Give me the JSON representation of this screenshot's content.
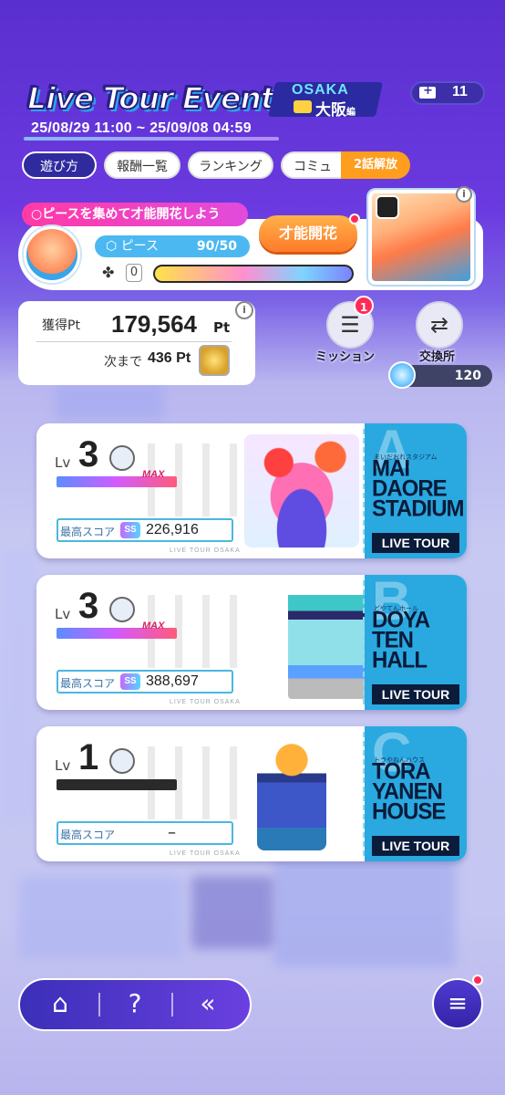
{
  "event": {
    "title": "Live Tour Event",
    "location_top": "OSAKA",
    "location_bottom": "大阪",
    "location_suffix": "編",
    "date_range": "25/08/29 11:00 ~ 25/09/08 04:59"
  },
  "tickets": {
    "count": "11"
  },
  "tabs": {
    "how_to_play": "遊び方",
    "rewards": "報酬一覧",
    "ranking": "ランキング",
    "commu": "コミュ",
    "commu_badge": "2話解放"
  },
  "talent": {
    "banner": "○ピースを集めて才能開花しよう",
    "piece_label": "ピース",
    "piece_value": "90/50",
    "clover_count": "0",
    "bloom_button": "才能開花",
    "info": "i"
  },
  "points": {
    "earned_label": "獲得Pt",
    "earned_value": "179,564",
    "earned_unit": "Pt",
    "next_label": "次まで",
    "next_value": "436 Pt",
    "info": "i"
  },
  "actions": {
    "mission_label": "ミッション",
    "mission_badge": "1",
    "exchange_label": "交換所",
    "coin_count": "120"
  },
  "stages": [
    {
      "letter": "A",
      "subtitle": "まいだおれスタジアム",
      "name": "MAI\nDAORE\nSTADIUM",
      "tour": "LIVE TOUR",
      "lv_label": "Lv",
      "level": "3",
      "max_label": "MAX",
      "score_label": "最高スコア",
      "score_rank": "SS",
      "score": "226,916",
      "footer": "LIVE TOUR OSAKA"
    },
    {
      "letter": "B",
      "subtitle": "どやてんホール",
      "name": "DOYA\nTEN\nHALL",
      "tour": "LIVE TOUR",
      "lv_label": "Lv",
      "level": "3",
      "max_label": "MAX",
      "score_label": "最高スコア",
      "score_rank": "SS",
      "score": "388,697",
      "footer": "LIVE TOUR OSAKA"
    },
    {
      "letter": "C",
      "subtitle": "トラやねんハウス",
      "name": "TORA\nYANEN\nHOUSE",
      "tour": "LIVE TOUR",
      "lv_label": "Lv",
      "level": "1",
      "score_label": "最高スコア",
      "score": "–",
      "footer": "LIVE TOUR OSAKA"
    }
  ],
  "icons": {
    "home": "home-icon",
    "help": "help-icon",
    "back": "back-icon",
    "menu": "menu-icon"
  },
  "colors": {
    "accent_orange": "#ff7a2a",
    "stub_blue": "#2aa9e0",
    "pink": "#ff3aa6"
  }
}
